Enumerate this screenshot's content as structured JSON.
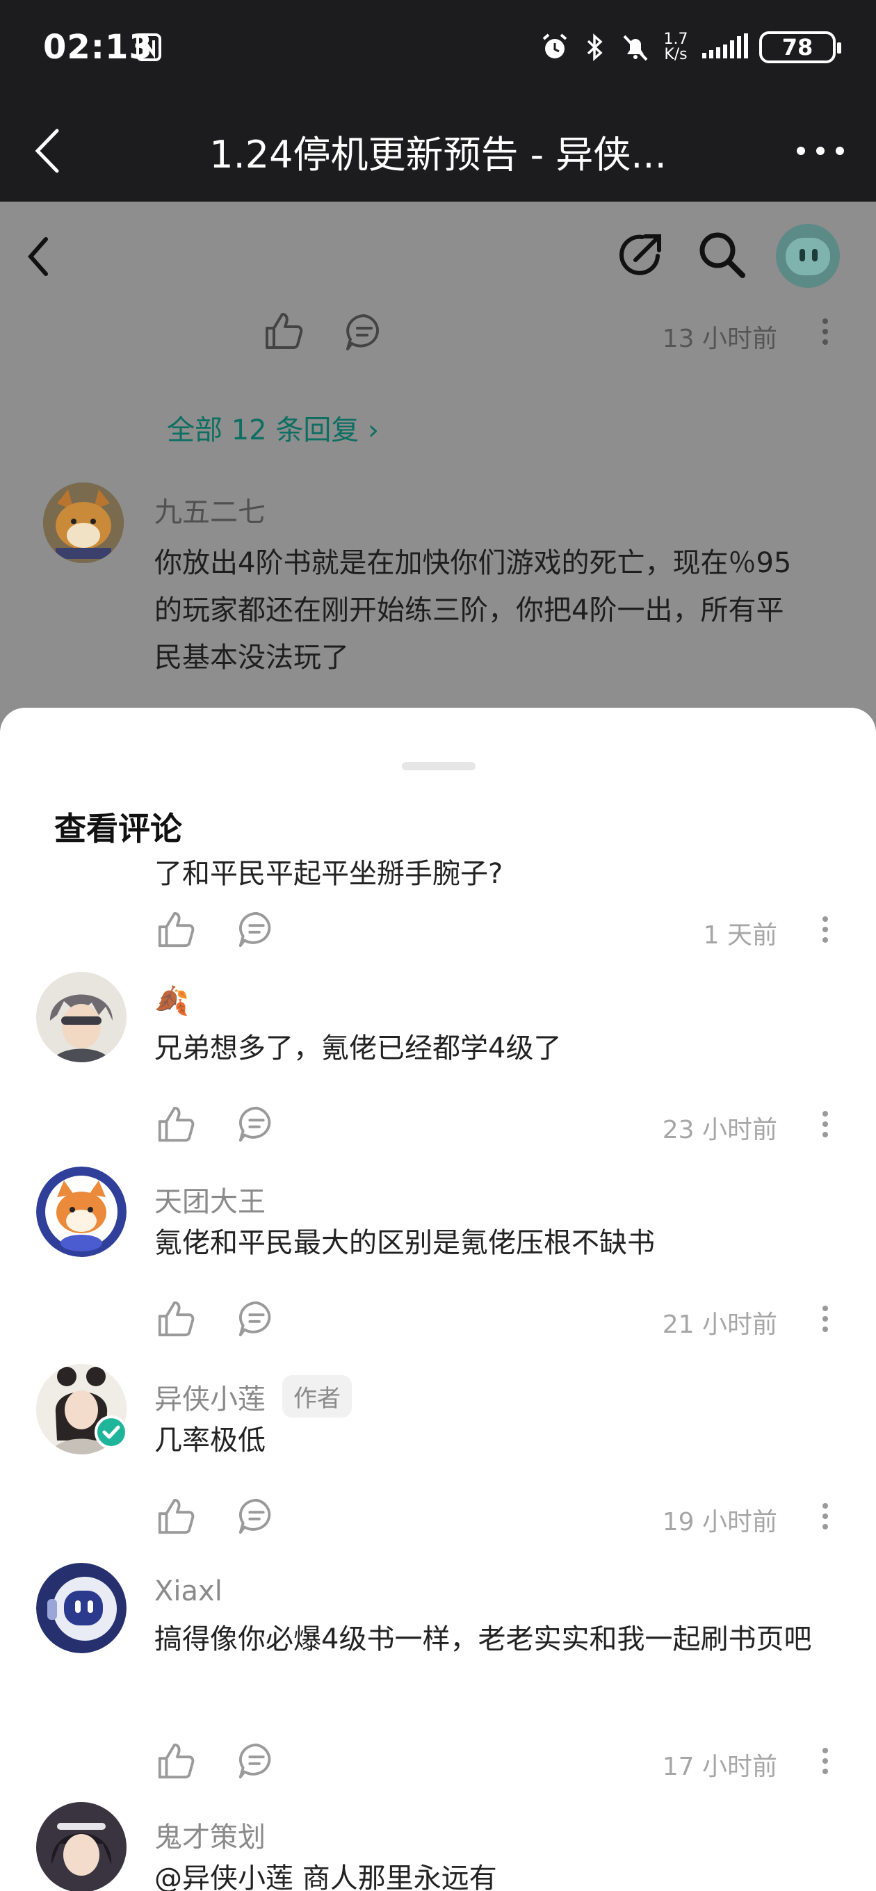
{
  "status_bar": {
    "time": "02:13",
    "net_speed_value": "1.7",
    "net_speed_unit": "K/s",
    "battery": "78"
  },
  "web_header": {
    "title": "1.24停机更新预告 - 异侠..."
  },
  "background_page": {
    "prev_comment_time": "13 小时前",
    "all_replies_label": "全部 12 条回复 ›",
    "comment": {
      "name": "九五二七",
      "text": "你放出4阶书就是在加快你们游戏的死亡，现在％95的玩家都还在刚开始练三阶，你把4阶一出，所有平民基本没法玩了"
    }
  },
  "sheet": {
    "title": "查看评论",
    "partial_text": "了和平民平起平坐掰手腕子?",
    "partial_time": "1 天前",
    "comments": [
      {
        "name": "🍂",
        "text": "兄弟想多了，氪佬已经都学4级了",
        "time": "23 小时前"
      },
      {
        "name": "天团大王",
        "text": "氪佬和平民最大的区别是氪佬压根不缺书",
        "time": "21 小时前"
      },
      {
        "name": "异侠小莲",
        "badge": "作者",
        "text": "几率极低",
        "time": "19 小时前"
      },
      {
        "name": "Xiaxl",
        "text": "搞得像你必爆4级书一样，老老实实和我一起刷书页吧",
        "time": "17 小时前"
      },
      {
        "name": "鬼才策划",
        "text": "@异侠小莲 商人那里永远有"
      }
    ]
  },
  "colors": {
    "status_bar_bg": "#1c1c1e",
    "accent_green": "#0d6e62",
    "verified_green": "#1fb59a"
  }
}
